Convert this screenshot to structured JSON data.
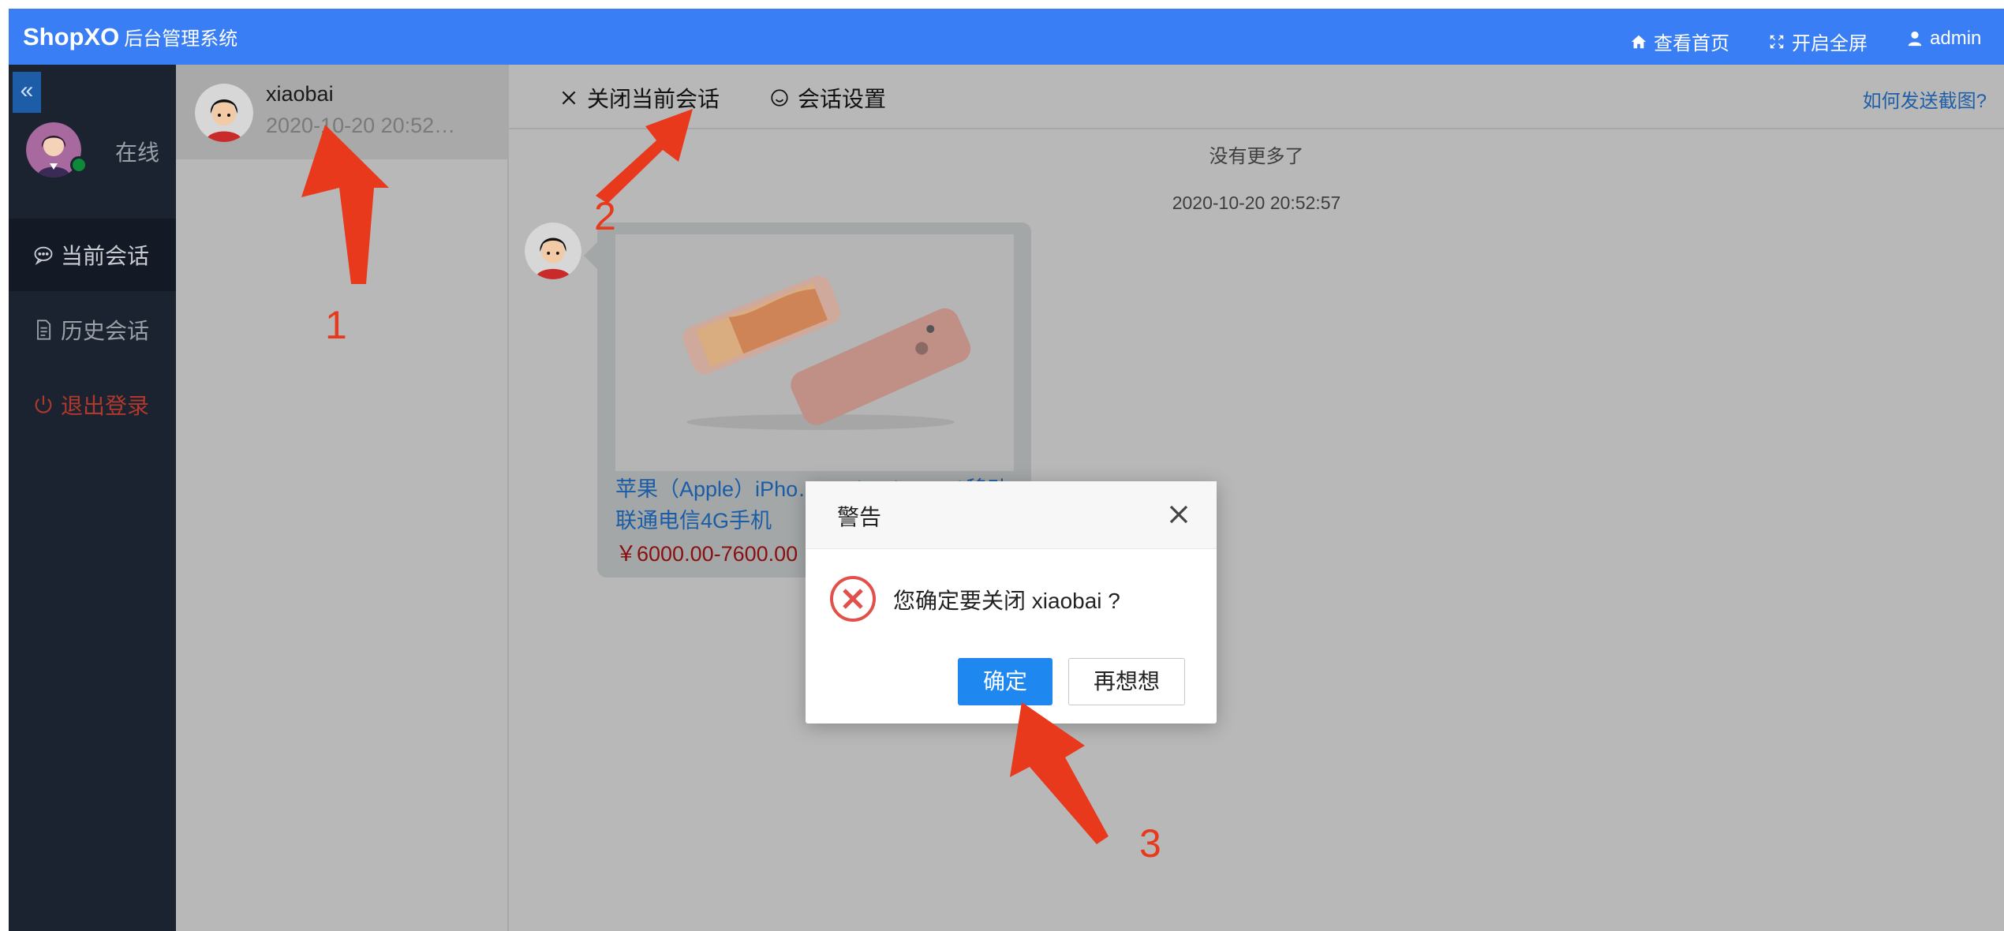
{
  "header": {
    "brand": "ShopXO",
    "subtitle": "后台管理系统",
    "links": {
      "home": "查看首页",
      "fullscreen": "开启全屏",
      "user": "admin"
    }
  },
  "sidebar": {
    "collapse_icon": "double-chevron-left-icon",
    "status": "在线",
    "items": [
      {
        "label": "当前会话",
        "icon": "chat-bubble-icon",
        "active": true
      },
      {
        "label": "历史会话",
        "icon": "document-icon",
        "active": false
      },
      {
        "label": "退出登录",
        "icon": "power-icon",
        "active": false
      }
    ]
  },
  "sessions": [
    {
      "name": "xiaobai",
      "time": "2020-10-20 20:52…"
    }
  ],
  "chat": {
    "toolbar": {
      "close_session": "关闭当前会话",
      "session_settings": "会话设置",
      "help": "如何发送截图?"
    },
    "no_more": "没有更多了",
    "message_time": "2020-10-20 20:52:57",
    "product": {
      "title": "苹果（Apple）iPho… 6 Plus (A1524)移动联通电信4G手机",
      "price": "￥6000.00-7600.00"
    }
  },
  "modal": {
    "title": "警告",
    "message": "您确定要关闭 xiaobai ?",
    "confirm": "确定",
    "cancel": "再想想"
  },
  "annotations": {
    "num1": "1",
    "num2": "2",
    "num3": "3"
  },
  "colors": {
    "header": "#3a7ef5",
    "sidebar": "#1c2330",
    "annotation": "#e8391c",
    "confirm": "#1e88f0"
  }
}
